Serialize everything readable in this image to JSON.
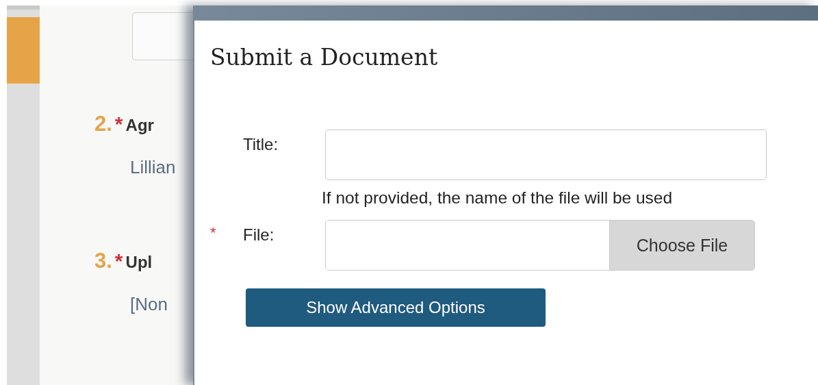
{
  "background": {
    "steps": [
      {
        "number": "2.",
        "required_mark": "*",
        "label": "Agr",
        "value": "Lillian"
      },
      {
        "number": "3.",
        "required_mark": "*",
        "label": "Upl",
        "value": "[Non"
      }
    ]
  },
  "dialog": {
    "title": "Submit a Document",
    "fields": [
      {
        "kind": "text",
        "label": "Title:",
        "hint": "If not provided, the name of the file will be used"
      },
      {
        "kind": "file",
        "required_mark": "*",
        "label": "File:",
        "button": "Choose File"
      }
    ],
    "button": "Show Advanced Options"
  }
}
